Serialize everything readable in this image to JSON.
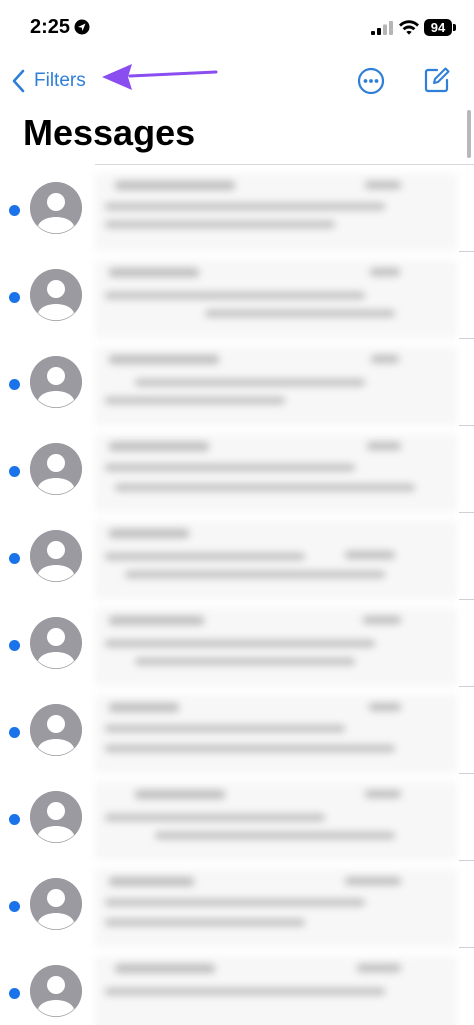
{
  "status_bar": {
    "time": "2:25",
    "battery": "94"
  },
  "nav": {
    "back_label": "Filters",
    "accent_color": "#2f7fd8"
  },
  "page": {
    "title": "Messages"
  },
  "conversations": [
    {
      "unread": true
    },
    {
      "unread": true
    },
    {
      "unread": true
    },
    {
      "unread": true
    },
    {
      "unread": true
    },
    {
      "unread": true
    },
    {
      "unread": true
    },
    {
      "unread": true
    },
    {
      "unread": true
    },
    {
      "unread": true
    }
  ],
  "icons": {
    "back": "chevron-left-icon",
    "more": "ellipsis-circle-icon",
    "compose": "compose-icon",
    "avatar": "person-avatar-icon",
    "annotation": "purple-arrow"
  }
}
